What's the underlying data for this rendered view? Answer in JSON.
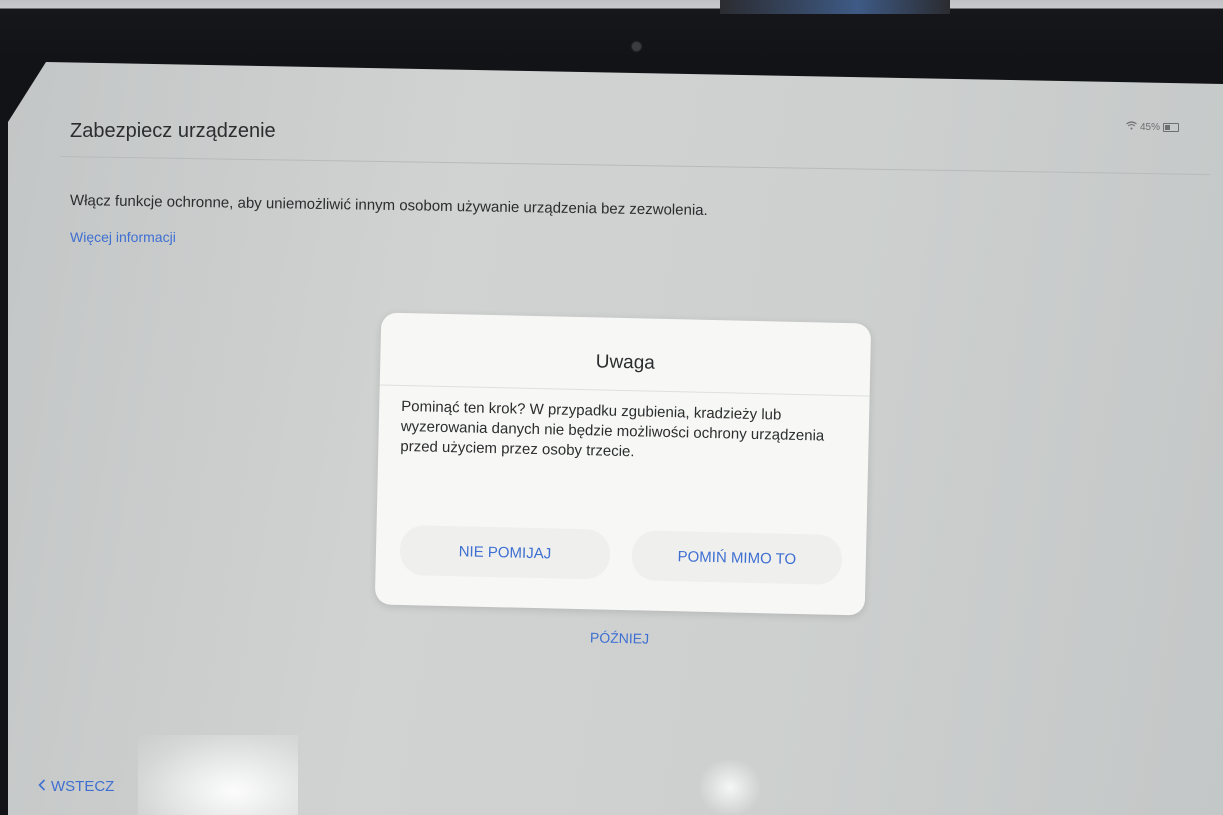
{
  "header": {
    "title": "Zabezpiecz urządzenie",
    "battery_percent": "45%",
    "status_icons": [
      "wifi-icon",
      "battery-icon"
    ]
  },
  "main": {
    "description": "Włącz funkcje ochronne, aby uniemożliwić innym osobom używanie urządzenia bez zezwolenia.",
    "more_info_link": "Więcej informacji",
    "later_button": "PÓŹNIEJ"
  },
  "dialog": {
    "title": "Uwaga",
    "message": "Pominąć ten krok? W przypadku zgubienia, kradzieży lub wyzerowania danych nie będzie możliwości ochrony urządzenia przed użyciem przez osoby trzecie.",
    "negative_button": "NIE POMIJAJ",
    "positive_button": "POMIŃ MIMO TO"
  },
  "footer": {
    "back_label": "WSTECZ",
    "back_icon": "chevron-left-icon"
  },
  "colors": {
    "accent": "#3e6fd1",
    "screen_background": "#cfd1d0",
    "dialog_background": "#f7f7f6",
    "text": "#2b2d2e"
  }
}
